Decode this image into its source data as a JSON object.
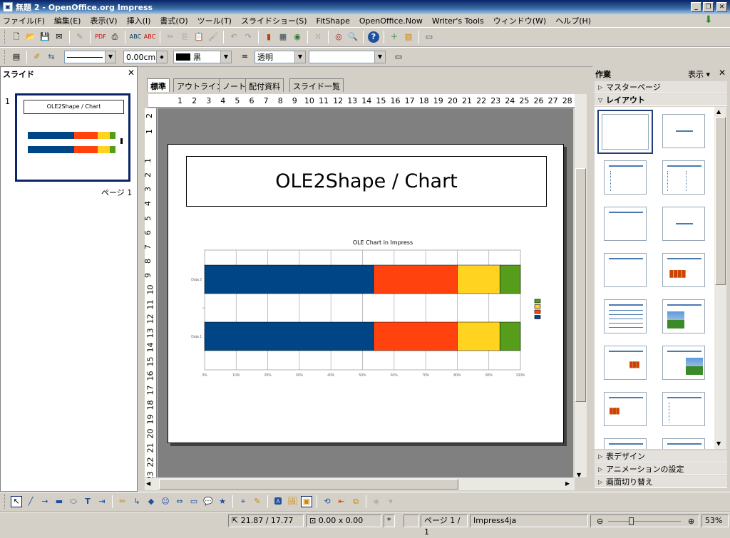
{
  "window": {
    "title": "無題 2 - OpenOffice.org Impress"
  },
  "menu": [
    "ファイル(F)",
    "編集(E)",
    "表示(V)",
    "挿入(I)",
    "書式(O)",
    "ツール(T)",
    "スライドショー(S)",
    "FitShape",
    "OpenOffice.Now",
    "Writer's Tools",
    "ウィンドウ(W)",
    "ヘルプ(H)"
  ],
  "line_toolbar": {
    "line_width": "0.00cm",
    "color_name": "黒",
    "transparency": "透明"
  },
  "slides_pane": {
    "title": "スライド",
    "slide_number": "1",
    "thumb_title": "OLE2Shape / Chart",
    "page_label": "ページ 1"
  },
  "view_tabs": [
    "標準",
    "アウトライン",
    "ノート",
    "配付資料",
    "スライド一覧"
  ],
  "rulers": {
    "h_ticks": [
      "1",
      "2",
      "3",
      "4",
      "5",
      "6",
      "7",
      "8",
      "9",
      "10",
      "11",
      "12",
      "13",
      "14",
      "15",
      "16",
      "17",
      "18",
      "19",
      "20",
      "21",
      "22",
      "23",
      "24",
      "25",
      "26",
      "27",
      "28"
    ],
    "v_ticks_top": [
      "2",
      "1"
    ],
    "v_ticks": [
      "1",
      "2",
      "3",
      "4",
      "5",
      "6",
      "7",
      "8",
      "9",
      "10",
      "11",
      "12",
      "13",
      "14",
      "15",
      "16",
      "17",
      "18",
      "19",
      "20",
      "21",
      "22",
      "23"
    ]
  },
  "slide": {
    "title": "OLE2Shape / Chart"
  },
  "chart_data": {
    "type": "bar",
    "orientation": "horizontal",
    "stacked": "percent",
    "title": "OLE Chart in Impress",
    "categories": [
      "Data 2",
      "Data 1"
    ],
    "series": [
      {
        "values": [
          53.5,
          53.5
        ],
        "color": "#004586"
      },
      {
        "values": [
          26.5,
          26.5
        ],
        "color": "#ff420e"
      },
      {
        "values": [
          13.5,
          13.5
        ],
        "color": "#ffd320"
      },
      {
        "values": [
          6.5,
          6.5
        ],
        "color": "#579d1c"
      }
    ],
    "x_ticks": [
      "0%",
      "10%",
      "20%",
      "30%",
      "40%",
      "50%",
      "60%",
      "70%",
      "80%",
      "90%",
      "100%"
    ],
    "xlim": [
      0,
      100
    ],
    "grid": true,
    "legend": "right"
  },
  "taskpane": {
    "title": "作業",
    "view_label": "表示",
    "sections": {
      "master": "マスターページ",
      "layout": "レイアウト",
      "table": "表デザイン",
      "animation": "アニメーションの設定",
      "transition": "画面切り替え"
    }
  },
  "status": {
    "position": "21.87 / 17.77",
    "size": "0.00 x 0.00",
    "modified": "*",
    "page": "ページ 1 / 1",
    "master": "Impress4ja",
    "zoom": "53%"
  }
}
